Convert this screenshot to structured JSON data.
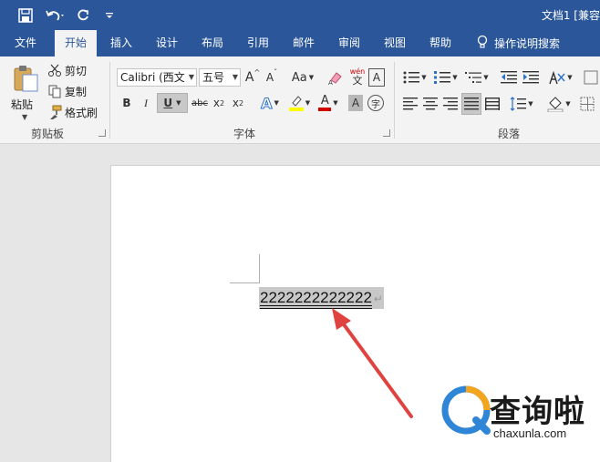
{
  "window": {
    "title": "文档1 [兼容"
  },
  "quick_access": [
    "save-icon",
    "undo-icon",
    "redo-icon",
    "customize-icon"
  ],
  "tabs": [
    "文件",
    "开始",
    "插入",
    "设计",
    "布局",
    "引用",
    "邮件",
    "审阅",
    "视图",
    "帮助"
  ],
  "tell_me": "操作说明搜索",
  "clipboard": {
    "paste": "粘贴",
    "cut": "剪切",
    "copy": "复制",
    "format_painter": "格式刷",
    "group": "剪贴板"
  },
  "font": {
    "name": "Calibri (西文",
    "size": "五号",
    "case_button": "Aa",
    "group": "字体",
    "bold": "B",
    "italic": "I",
    "underline": "U",
    "strikethrough": "abc",
    "subscript": "x",
    "superscript": "x",
    "sub_mark": "2",
    "sup_mark": "2",
    "phonetic": "wén",
    "char_border": "A",
    "text_effect": "A",
    "font_color": "A",
    "char_shading": "A",
    "enclose": "字"
  },
  "paragraph": {
    "group": "段落"
  },
  "document": {
    "text": "2222222222222",
    "pilcrow": "↵"
  },
  "watermark": {
    "name": "查询啦",
    "domain": "chaxunla.com"
  },
  "colors": {
    "accent": "#2b579a",
    "highlight": "#ffff00",
    "font_red": "#d00000",
    "arrow": "#e0433f"
  }
}
